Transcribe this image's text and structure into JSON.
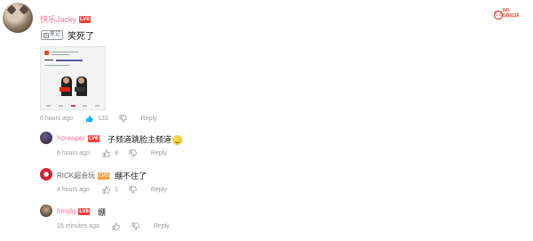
{
  "logo": {
    "line1": "NO.",
    "line2": "DB9226",
    "accent": "#e0462f"
  },
  "main_comment": {
    "username": "快乐Jacky",
    "level": "LV6",
    "tag": "笔记",
    "text": "笑死了",
    "timestamp": "6 hours ago",
    "likes": "133",
    "reply_label": "Reply"
  },
  "replies": [
    {
      "username": "horeaper",
      "level": "LV6",
      "text": "子频道跳脸主频道",
      "emoji": "laugh-emoji",
      "timestamp": "6 hours ago",
      "likes": "8",
      "reply_label": "Reply"
    },
    {
      "username": "RICK超会玩",
      "level": "LV5",
      "text": "绷不住了",
      "timestamp": "4 hours ago",
      "likes": "1",
      "reply_label": "Reply"
    },
    {
      "username": "hmylg",
      "level": "LV6",
      "text": "绷",
      "timestamp": "15 minutes ago",
      "likes": "",
      "reply_label": "Reply"
    }
  ],
  "colors": {
    "username_pink": "#fb7299",
    "meta_gray": "#9499a0",
    "like_blue": "#00aeec",
    "level6": "#ff3f3f",
    "level5": "#ff9a3c"
  }
}
